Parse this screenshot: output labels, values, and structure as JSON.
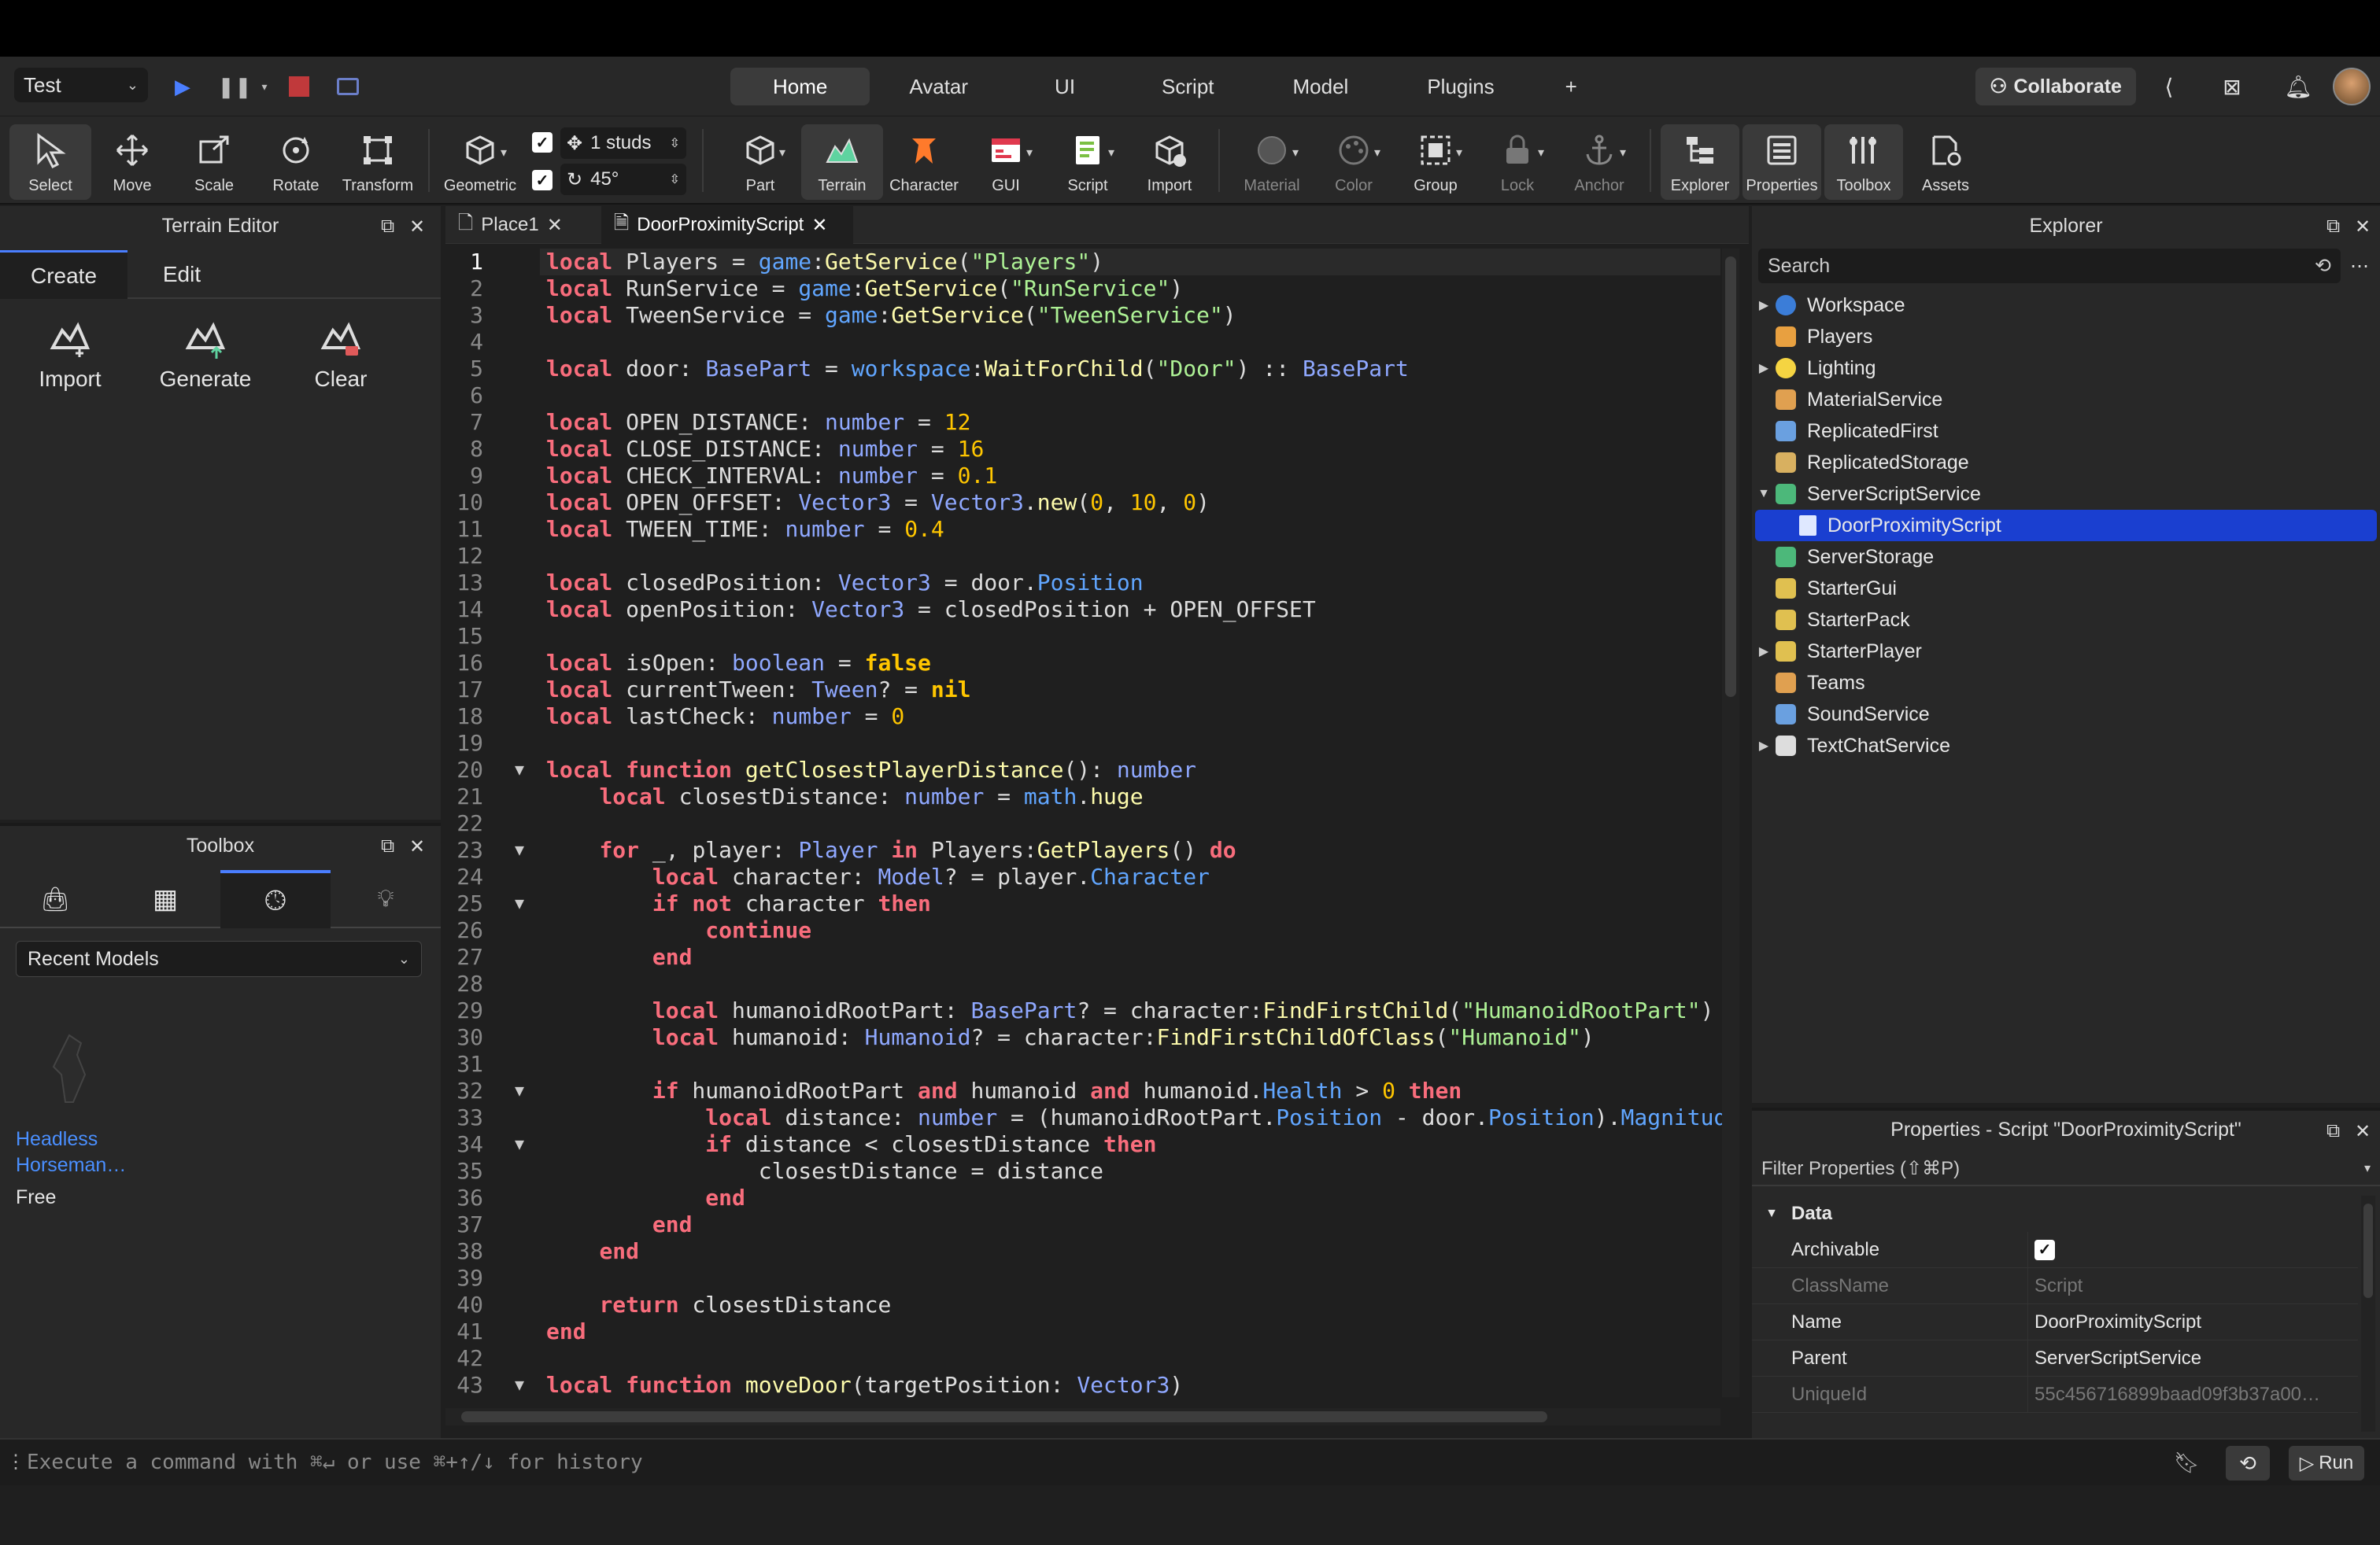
{
  "topbar": {
    "test_label": "Test",
    "tabs": [
      "Home",
      "Avatar",
      "UI",
      "Script",
      "Model",
      "Plugins"
    ],
    "plus": "+",
    "collaborate": "Collaborate"
  },
  "ribbon": {
    "tools": [
      "Select",
      "Move",
      "Scale",
      "Rotate",
      "Transform",
      "Geometric",
      "Part",
      "Terrain",
      "Character",
      "GUI",
      "Script",
      "Import",
      "Material",
      "Color",
      "Group",
      "Lock",
      "Anchor",
      "Explorer",
      "Properties",
      "Toolbox",
      "Assets"
    ],
    "studs": "1 studs",
    "angle": "45°"
  },
  "terrain_editor": {
    "title": "Terrain Editor",
    "tabs": [
      "Create",
      "Edit"
    ],
    "buttons": [
      "Import",
      "Generate",
      "Clear"
    ]
  },
  "toolbox": {
    "title": "Toolbox",
    "category": "Recent Models",
    "model_name": "Headless Horseman…",
    "model_price": "Free"
  },
  "editor": {
    "tabs": [
      "Place1",
      "DoorProximityScript"
    ]
  },
  "explorer": {
    "title": "Explorer",
    "search_placeholder": "Search",
    "items": [
      {
        "label": "Workspace",
        "color": "#3b7dd8"
      },
      {
        "label": "Players",
        "color": "#e8a040"
      },
      {
        "label": "Lighting",
        "color": "#f5d442"
      },
      {
        "label": "MaterialService",
        "color": "#e0a050"
      },
      {
        "label": "ReplicatedFirst",
        "color": "#6aa0e0"
      },
      {
        "label": "ReplicatedStorage",
        "color": "#d8b060"
      },
      {
        "label": "ServerScriptService",
        "color": "#4cb87a"
      },
      {
        "label": "DoorProximityScript",
        "color": "#dfe8ff"
      },
      {
        "label": "ServerStorage",
        "color": "#4cb87a"
      },
      {
        "label": "StarterGui",
        "color": "#e0c050"
      },
      {
        "label": "StarterPack",
        "color": "#e0c050"
      },
      {
        "label": "StarterPlayer",
        "color": "#e0c050"
      },
      {
        "label": "Teams",
        "color": "#e0a050"
      },
      {
        "label": "SoundService",
        "color": "#6aa0e0"
      },
      {
        "label": "TextChatService",
        "color": "#dddddd"
      }
    ]
  },
  "properties": {
    "title": "Properties - Script \"DoorProximityScript\"",
    "filter": "Filter Properties (⇧⌘P)",
    "section": "Data",
    "rows": [
      {
        "key": "Archivable",
        "value": ""
      },
      {
        "key": "ClassName",
        "value": "Script"
      },
      {
        "key": "Name",
        "value": "DoorProximityScript"
      },
      {
        "key": "Parent",
        "value": "ServerScriptService"
      },
      {
        "key": "UniqueId",
        "value": "55c456716899baad09f3b37a00…"
      }
    ]
  },
  "command_bar": {
    "placeholder": "Execute a command with ⌘↵ or use ⌘+↑/↓ for history",
    "run": "Run"
  }
}
